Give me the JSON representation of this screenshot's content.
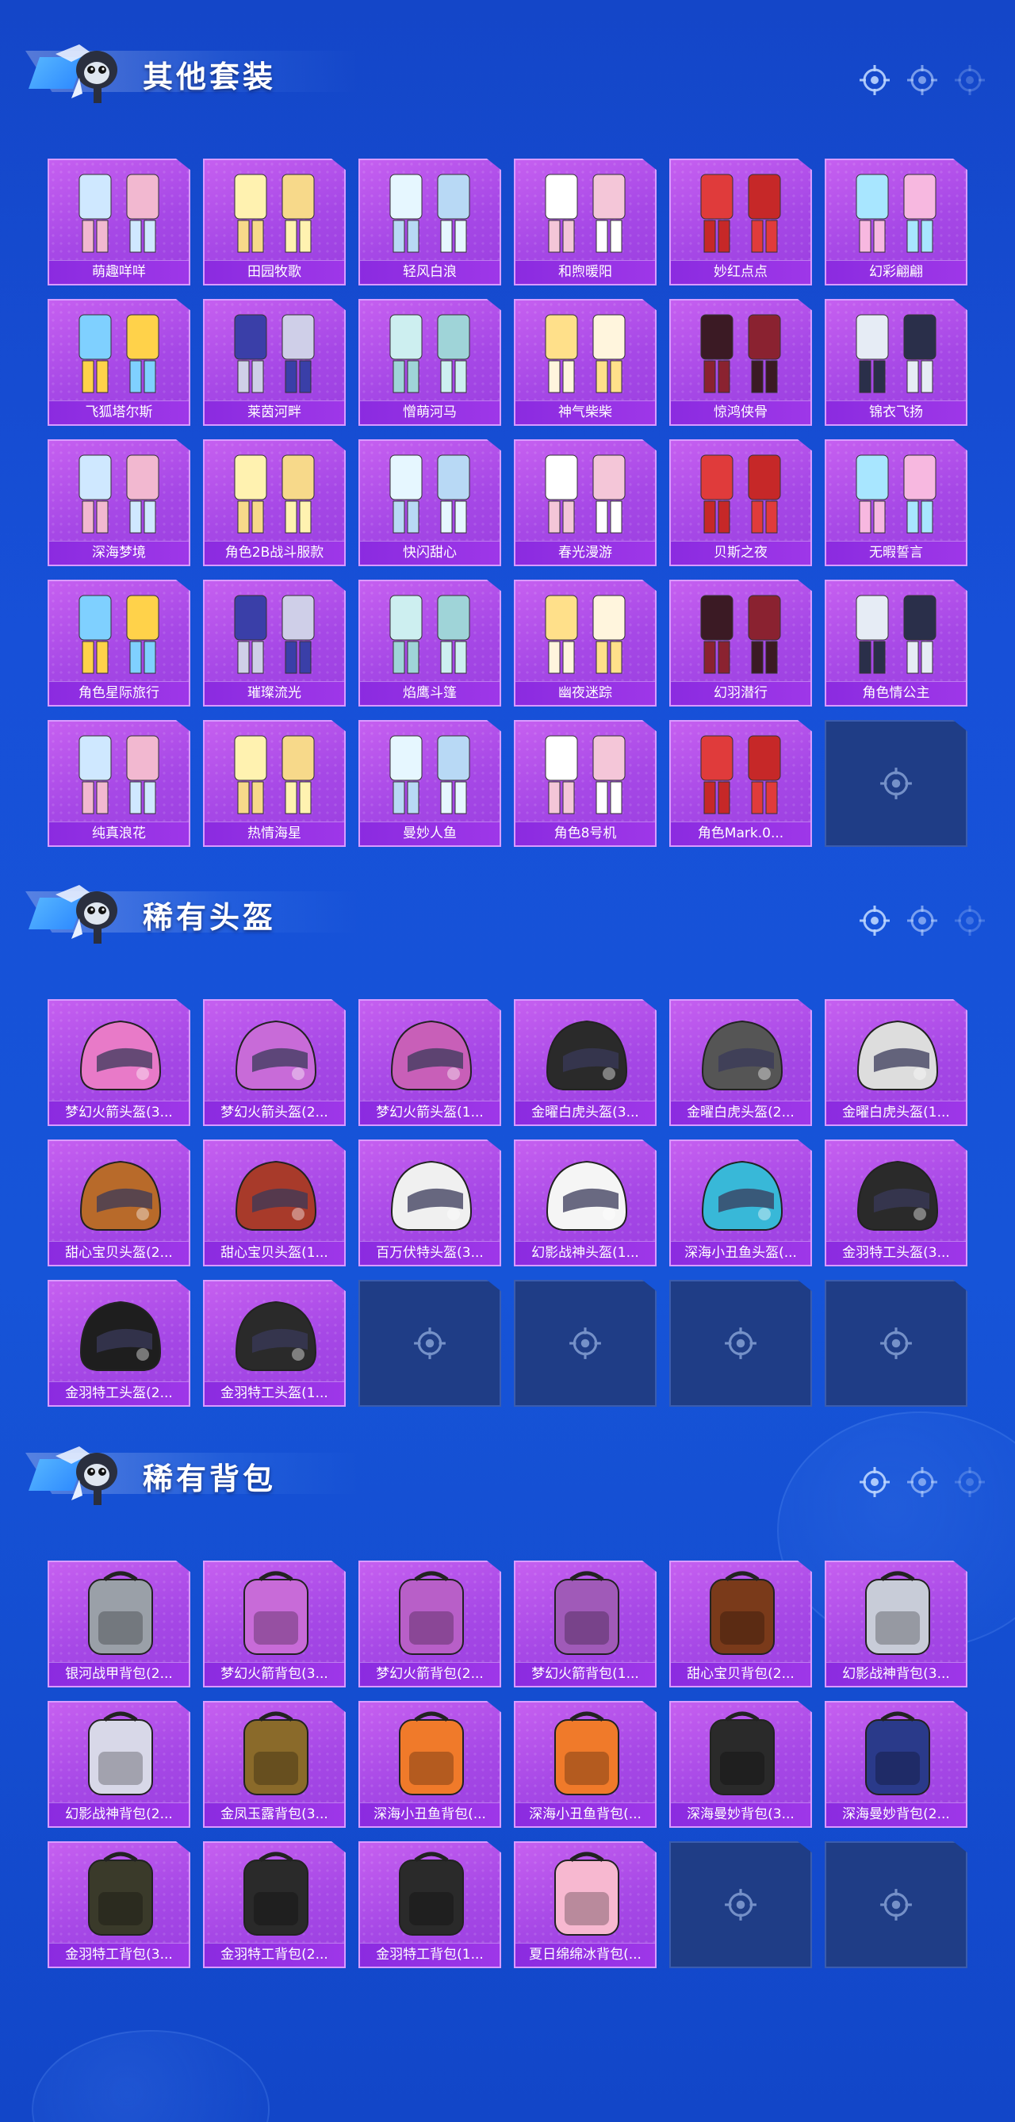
{
  "sections": [
    {
      "title": "其他套装",
      "items": [
        "萌趣咩咩",
        "田园牧歌",
        "轻风白浪",
        "和煦暖阳",
        "妙红点点",
        "幻彩翩翩",
        "飞狐塔尔斯",
        "莱茵河畔",
        "憎萌河马",
        "神气柴柴",
        "惊鸿侠骨",
        "锦衣飞扬",
        "深海梦境",
        "角色2B战斗服款",
        "快闪甜心",
        "春光漫游",
        "贝斯之夜",
        "无暇誓言",
        "角色星际旅行",
        "璀璨流光",
        "焰鹰斗篷",
        "幽夜迷踪",
        "幻羽潜行",
        "角色情公主",
        "纯真浪花",
        "热情海星",
        "曼妙人鱼",
        "角色8号机",
        "角色Mark.0..."
      ],
      "empty_slots": 1
    },
    {
      "title": "稀有头盔",
      "items": [
        "梦幻火箭头盔(3...",
        "梦幻火箭头盔(2...",
        "梦幻火箭头盔(1...",
        "金曜白虎头盔(3...",
        "金曜白虎头盔(2...",
        "金曜白虎头盔(1...",
        "甜心宝贝头盔(2...",
        "甜心宝贝头盔(1...",
        "百万伏特头盔(3...",
        "幻影战神头盔(1...",
        "深海小丑鱼头盔(...",
        "金羽特工头盔(3...",
        "金羽特工头盔(2...",
        "金羽特工头盔(1..."
      ],
      "empty_slots": 4
    },
    {
      "title": "稀有背包",
      "items": [
        "银河战甲背包(2...",
        "梦幻火箭背包(3...",
        "梦幻火箭背包(2...",
        "梦幻火箭背包(1...",
        "甜心宝贝背包(2...",
        "幻影战神背包(3...",
        "幻影战神背包(2...",
        "金凤玉露背包(3...",
        "深海小丑鱼背包(...",
        "深海小丑鱼背包(...",
        "深海曼妙背包(3...",
        "深海曼妙背包(2...",
        "金羽特工背包(3...",
        "金羽特工背包(2...",
        "金羽特工背包(1...",
        "夏日绵绵冰背包(..."
      ],
      "empty_slots": 2
    }
  ],
  "colors": {
    "card_purple": "#a648e6",
    "label_purple": "#8b2be0",
    "empty_slot": "#1f3d86",
    "background_blue": "#1750d8"
  }
}
